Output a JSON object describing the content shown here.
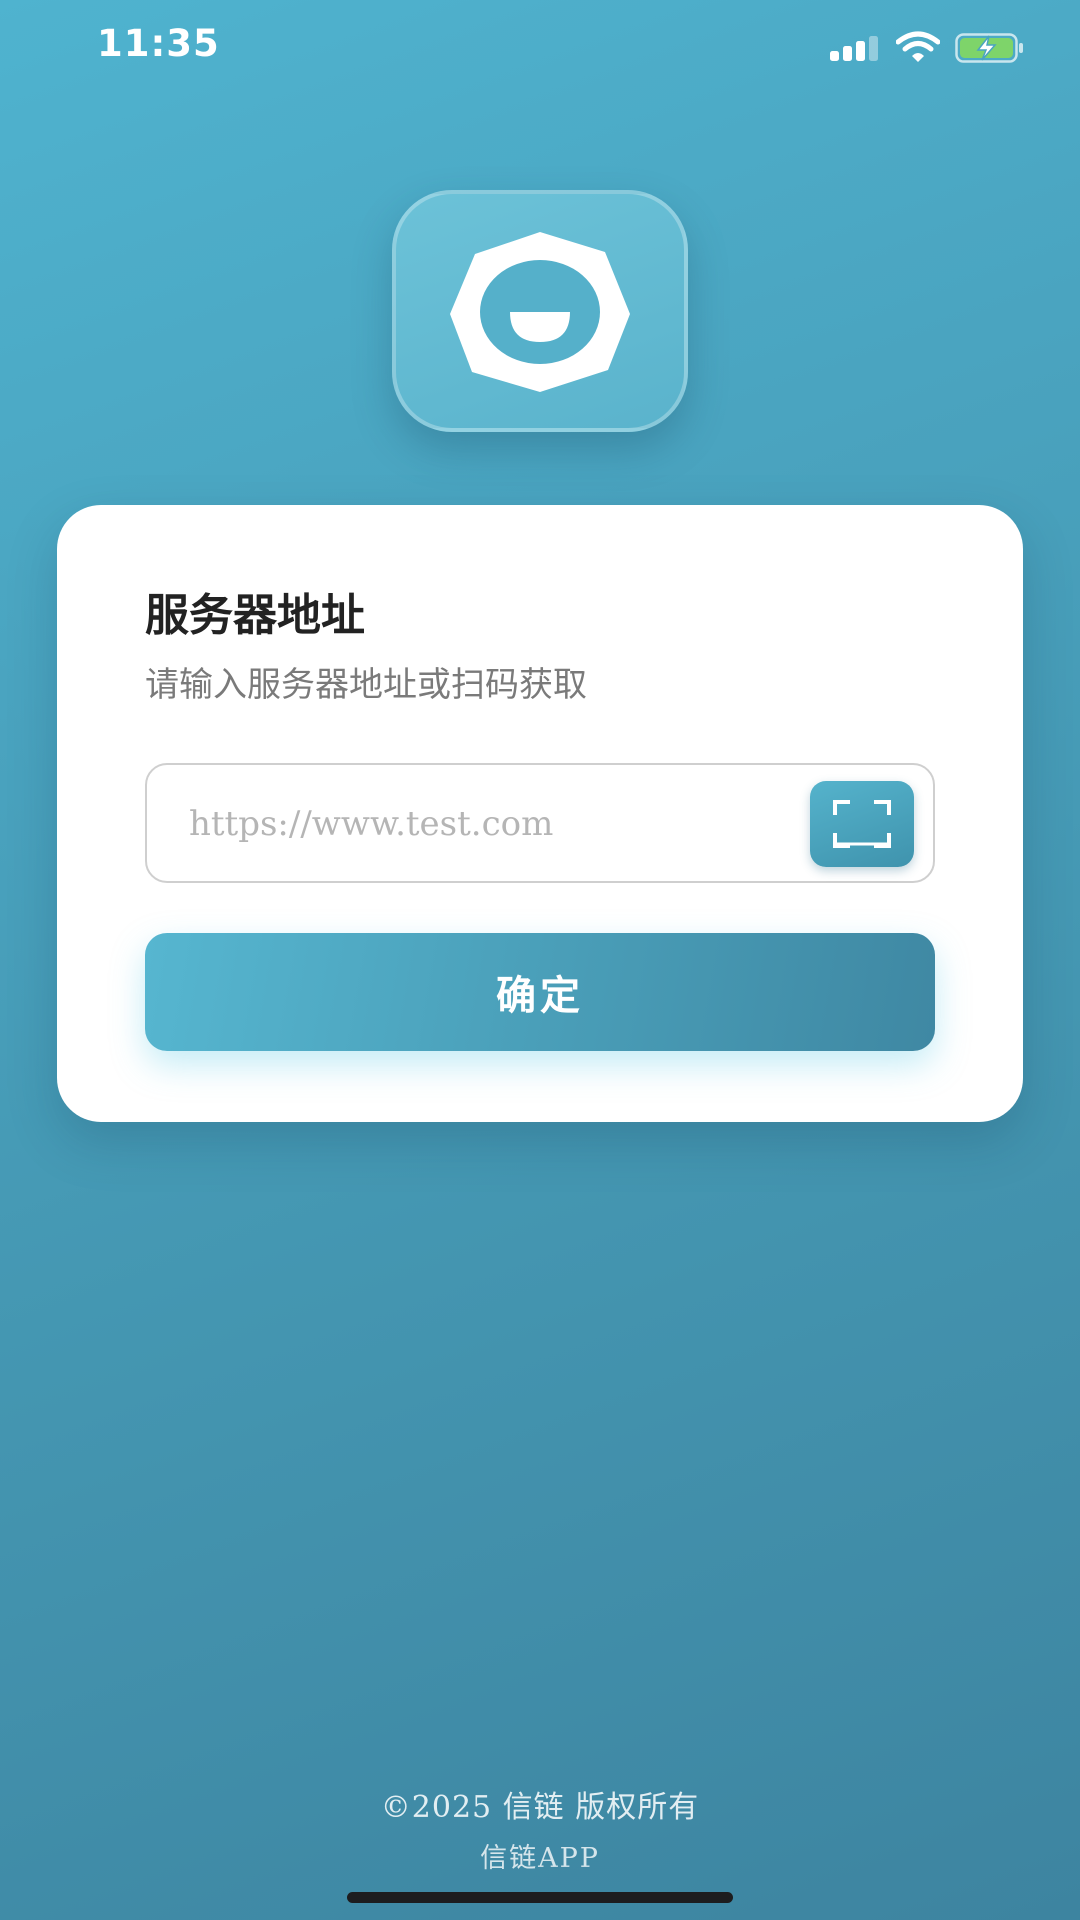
{
  "status_bar": {
    "time": "11:35",
    "icons": [
      "cellular-signal-icon",
      "wifi-icon",
      "battery-charging-icon"
    ],
    "battery_color": "#7ed46a"
  },
  "logo": {
    "icon": "app-logo-icon",
    "background": "#5ab3cc"
  },
  "card": {
    "title": "服务器地址",
    "subtitle": "请输入服务器地址或扫码获取",
    "input": {
      "value": "",
      "placeholder": "https://www.test.com"
    },
    "scan_icon": "qr-scan-icon",
    "confirm_label": "确定"
  },
  "footer": {
    "copyright": "©2025 信链 版权所有",
    "app_name": "信链APP"
  },
  "colors": {
    "accent": "#4aa4c0",
    "background_start": "#4fb3cf",
    "background_end": "#3d84a0"
  }
}
